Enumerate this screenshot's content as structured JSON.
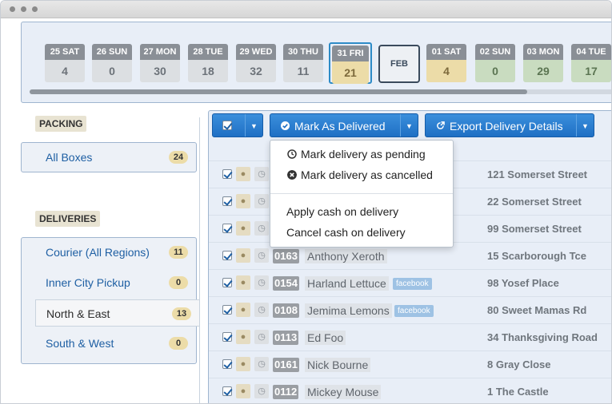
{
  "window": {
    "title": ""
  },
  "date_strip": {
    "days": [
      {
        "label": "25 SAT",
        "count": "4",
        "style": "grey"
      },
      {
        "label": "26 SUN",
        "count": "0",
        "style": "grey"
      },
      {
        "label": "27 MON",
        "count": "30",
        "style": "grey"
      },
      {
        "label": "28 TUE",
        "count": "18",
        "style": "grey"
      },
      {
        "label": "29 WED",
        "count": "32",
        "style": "grey"
      },
      {
        "label": "30 THU",
        "count": "11",
        "style": "grey"
      },
      {
        "label": "31 FRI",
        "count": "21",
        "style": "yellow",
        "selected": true
      },
      {
        "label": "01 SAT",
        "count": "4",
        "style": "yellow"
      },
      {
        "label": "02 SUN",
        "count": "0",
        "style": "green"
      },
      {
        "label": "03 MON",
        "count": "29",
        "style": "green"
      },
      {
        "label": "04 TUE",
        "count": "17",
        "style": "green"
      }
    ],
    "month_label": "FEB"
  },
  "sidebar": {
    "packing_heading": "PACKING",
    "packing_items": [
      {
        "label": "All Boxes",
        "count": "24"
      }
    ],
    "deliveries_heading": "DELIVERIES",
    "delivery_items": [
      {
        "label": "Courier (All Regions)",
        "count": "11"
      },
      {
        "label": "Inner City Pickup",
        "count": "0"
      },
      {
        "label": "North & East",
        "count": "13",
        "active": true
      },
      {
        "label": "South & West",
        "count": "0"
      }
    ]
  },
  "toolbar": {
    "mark_delivered_label": "Mark As Delivered",
    "export_label": "Export Delivery Details"
  },
  "dropdown_menu": {
    "items": [
      {
        "label": "Mark delivery as pending",
        "icon": "clock-icon"
      },
      {
        "label": "Mark delivery as cancelled",
        "icon": "cancel-icon"
      }
    ],
    "items_secondary": [
      {
        "label": "Apply cash on delivery"
      },
      {
        "label": "Cancel cash on delivery"
      }
    ]
  },
  "deliveries": [
    {
      "id": "",
      "name": "",
      "source": "",
      "address": "121 Somerset Street"
    },
    {
      "id": "",
      "name": "",
      "source": "",
      "address": "22 Somerset Street"
    },
    {
      "id": "",
      "name": "",
      "source": "",
      "address": "99 Somerset Street"
    },
    {
      "id": "0163",
      "name": "Anthony Xeroth",
      "source": "",
      "address": "15 Scarborough Tce"
    },
    {
      "id": "0154",
      "name": "Harland Lettuce",
      "source": "facebook",
      "address": "98 Yosef Place"
    },
    {
      "id": "0108",
      "name": "Jemima Lemons",
      "source": "facebook",
      "address": "80 Sweet Mamas Rd"
    },
    {
      "id": "0113",
      "name": "Ed Foo",
      "source": "",
      "address": "34 Thanksgiving Road"
    },
    {
      "id": "0161",
      "name": "Nick Bourne",
      "source": "",
      "address": "8 Gray Close"
    },
    {
      "id": "0112",
      "name": "Mickey Mouse",
      "source": "",
      "address": "1 The Castle"
    }
  ],
  "colors": {
    "primary_button": "#2a7fd2",
    "badge_yellow": "#ecdca8",
    "badge_green": "#c9dcc0",
    "badge_grey": "#dcdfe2",
    "link_blue": "#1e5fa3"
  }
}
